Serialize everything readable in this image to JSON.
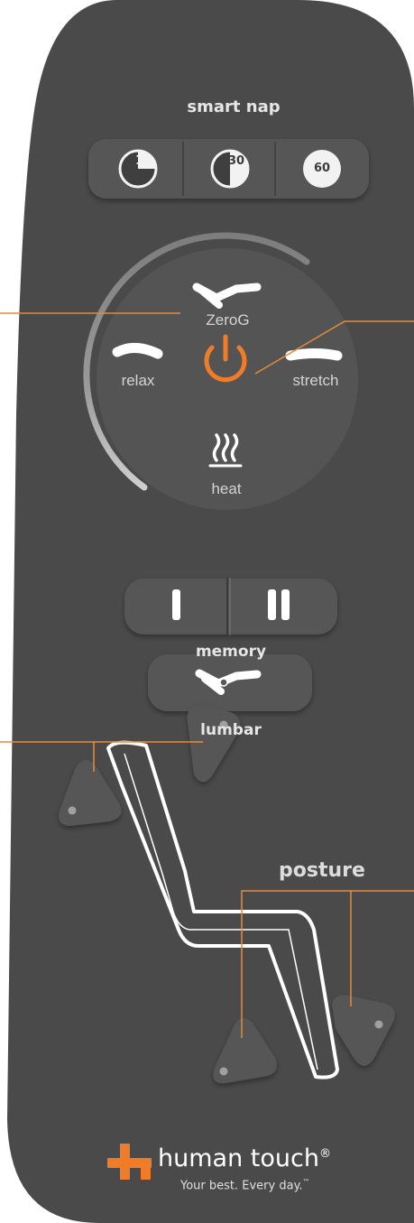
{
  "smart_nap": {
    "title": "smart nap",
    "timers": [
      {
        "label": "15",
        "fill_fraction": 0.25
      },
      {
        "label": "30",
        "fill_fraction": 0.5
      },
      {
        "label": "60",
        "fill_fraction": 1.0
      }
    ]
  },
  "mode_dial": {
    "zerog_label": "ZeroG",
    "relax_label": "relax",
    "stretch_label": "stretch",
    "heat_label": "heat",
    "power_icon": "power-icon"
  },
  "memory": {
    "title": "memory",
    "buttons": [
      {
        "label": "I"
      },
      {
        "label": "II"
      }
    ]
  },
  "lumbar": {
    "title": "lumbar"
  },
  "posture": {
    "title": "posture"
  },
  "brand": {
    "name": "human touch",
    "registered": "®",
    "tagline": "Your best. Every day.",
    "trademark": "™",
    "accent_color": "#f07c28"
  },
  "colors": {
    "body": "#4a4a4a",
    "button": "#555555",
    "accent": "#f07c28",
    "callout_line": "#e58a3c"
  }
}
